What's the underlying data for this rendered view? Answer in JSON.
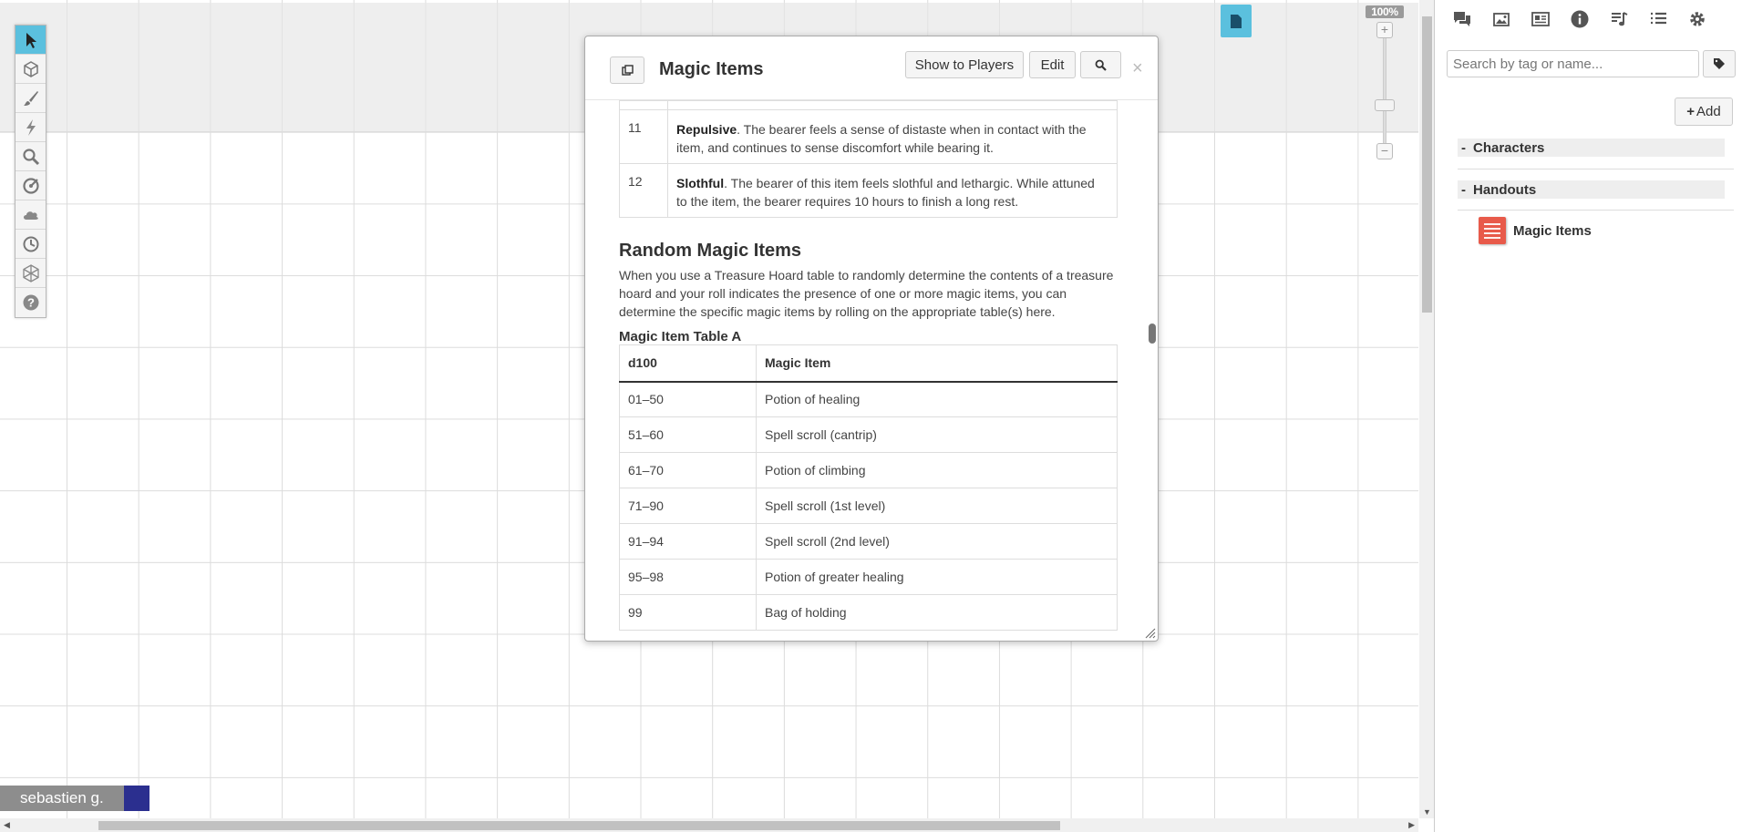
{
  "canvas": {
    "zoom_label": "100%",
    "zoom_plus": "+",
    "zoom_minus": "−",
    "player": {
      "name": "sebastien g.",
      "color": "#2b2f8f"
    }
  },
  "toolbar": {
    "tools": [
      {
        "name": "select-tool-icon",
        "active": true
      },
      {
        "name": "layer-tool-icon",
        "active": false
      },
      {
        "name": "draw-tool-icon",
        "active": false
      },
      {
        "name": "fx-tool-icon",
        "active": false
      },
      {
        "name": "zoom-tool-icon",
        "active": false
      },
      {
        "name": "measure-tool-icon",
        "active": false
      },
      {
        "name": "fog-tool-icon",
        "active": false
      },
      {
        "name": "turn-tracker-icon",
        "active": false
      },
      {
        "name": "dice-roller-icon",
        "active": false
      },
      {
        "name": "help-icon",
        "active": false
      }
    ]
  },
  "dialog": {
    "title": "Magic Items",
    "show_to_players": "Show to Players",
    "edit": "Edit",
    "close": "×",
    "flaw_rows": [
      {
        "num": "11",
        "name": "Repulsive",
        "text": ". The bearer feels a sense of distaste when in contact with the item, and continues to sense discomfort while bearing it."
      },
      {
        "num": "12",
        "name": "Slothful",
        "text": ". The bearer of this item feels slothful and lethargic. While attuned to the item, the bearer requires 10 hours to finish a long rest."
      }
    ],
    "section_title": "Random Magic Items",
    "section_text": "When you use a Treasure Hoard table to randomly determine the contents of a treasure hoard and your roll indicates the presence of one or more magic items, you can determine the specific magic items by rolling on the appropriate table(s) here.",
    "table_caption": "Magic Item Table A",
    "table_headers": [
      "d100",
      "Magic Item"
    ],
    "table_rows": [
      [
        "01–50",
        "Potion of healing"
      ],
      [
        "51–60",
        "Spell scroll (cantrip)"
      ],
      [
        "61–70",
        "Potion of climbing"
      ],
      [
        "71–90",
        "Spell scroll (1st level)"
      ],
      [
        "91–94",
        "Spell scroll (2nd level)"
      ],
      [
        "95–98",
        "Potion of greater healing"
      ],
      [
        "99",
        "Bag of holding"
      ]
    ]
  },
  "sidebar": {
    "tabs": [
      "chat-icon",
      "art-library-icon",
      "journal-icon",
      "compendium-icon",
      "jukebox-icon",
      "collections-icon",
      "settings-icon"
    ],
    "search_placeholder": "Search by tag or name...",
    "add_label": "Add",
    "folders": [
      {
        "minus": "-",
        "label": "Characters"
      },
      {
        "minus": "-",
        "label": "Handouts"
      }
    ],
    "handout": {
      "name": "Magic Items",
      "icon_color": "#e85a4a"
    }
  }
}
